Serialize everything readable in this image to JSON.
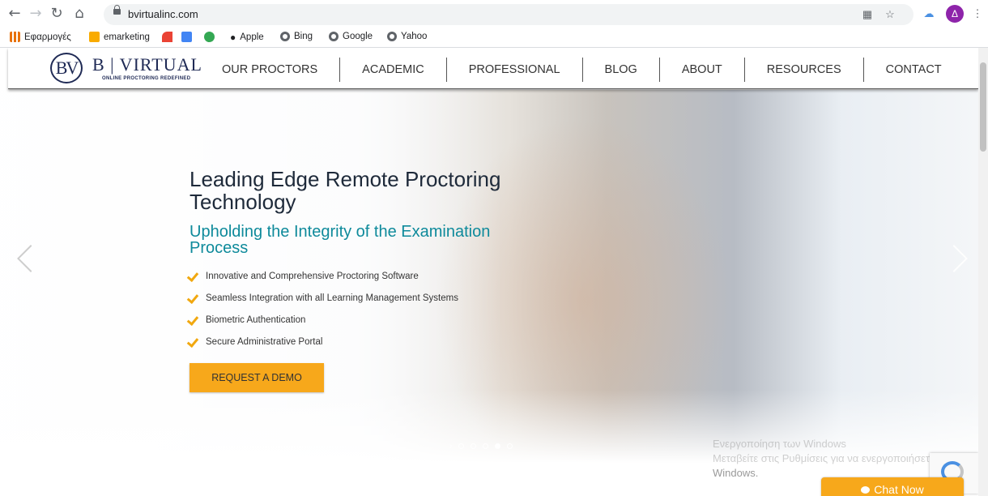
{
  "browser": {
    "url": "bvirtualinc.com",
    "profile_initial": "Δ",
    "bookmarks": [
      {
        "label": "Εφαρμογές",
        "icon": "apps-grid-icon",
        "color": "#e8710a"
      },
      {
        "label": "emarketing",
        "icon": "folder-icon",
        "color": "#f9ab00"
      },
      {
        "label": "",
        "icon": "wifi-bookmark-icon",
        "color": "#ea4335"
      },
      {
        "label": "",
        "icon": "calendar-bookmark-icon",
        "color": "#4285f4"
      },
      {
        "label": "",
        "icon": "green-bookmark-icon",
        "color": "#34a853"
      },
      {
        "label": "Apple",
        "icon": "apple-icon",
        "color": "#5f6368"
      },
      {
        "label": "Bing",
        "icon": "globe-icon",
        "color": "#5f6368"
      },
      {
        "label": "Google",
        "icon": "globe-icon",
        "color": "#5f6368"
      },
      {
        "label": "Yahoo",
        "icon": "globe-icon",
        "color": "#5f6368"
      }
    ]
  },
  "site": {
    "logo": {
      "mark": "BV",
      "name": "B | VIRTUAL",
      "tagline": "ONLINE PROCTORING REDEFINED"
    },
    "nav": [
      "OUR PROCTORS",
      "ACADEMIC",
      "PROFESSIONAL",
      "BLOG",
      "ABOUT",
      "RESOURCES",
      "CONTACT"
    ],
    "hero": {
      "headline": "Leading Edge Remote Proctoring Technology",
      "subheadline": "Upholding the Integrity of the Examination Process",
      "features": [
        "Innovative and Comprehensive Proctoring Software",
        "Seamless Integration with all Learning Management Systems",
        "Biometric Authentication",
        "Secure Administrative Portal"
      ],
      "cta": "REQUEST A DEMO",
      "slide_count": 5,
      "active_slide": 4
    },
    "chat": {
      "label": "Chat Now"
    },
    "overlay": {
      "line1": "Ενεργοποίηση των Windows",
      "line2": "Μεταβείτε στις Ρυθμίσεις για να ενεργοποιήσετε τα",
      "line3": "Windows."
    }
  },
  "colors": {
    "accent": "#f7a81b",
    "teal": "#0e8a9b",
    "navy": "#1f2a55"
  }
}
